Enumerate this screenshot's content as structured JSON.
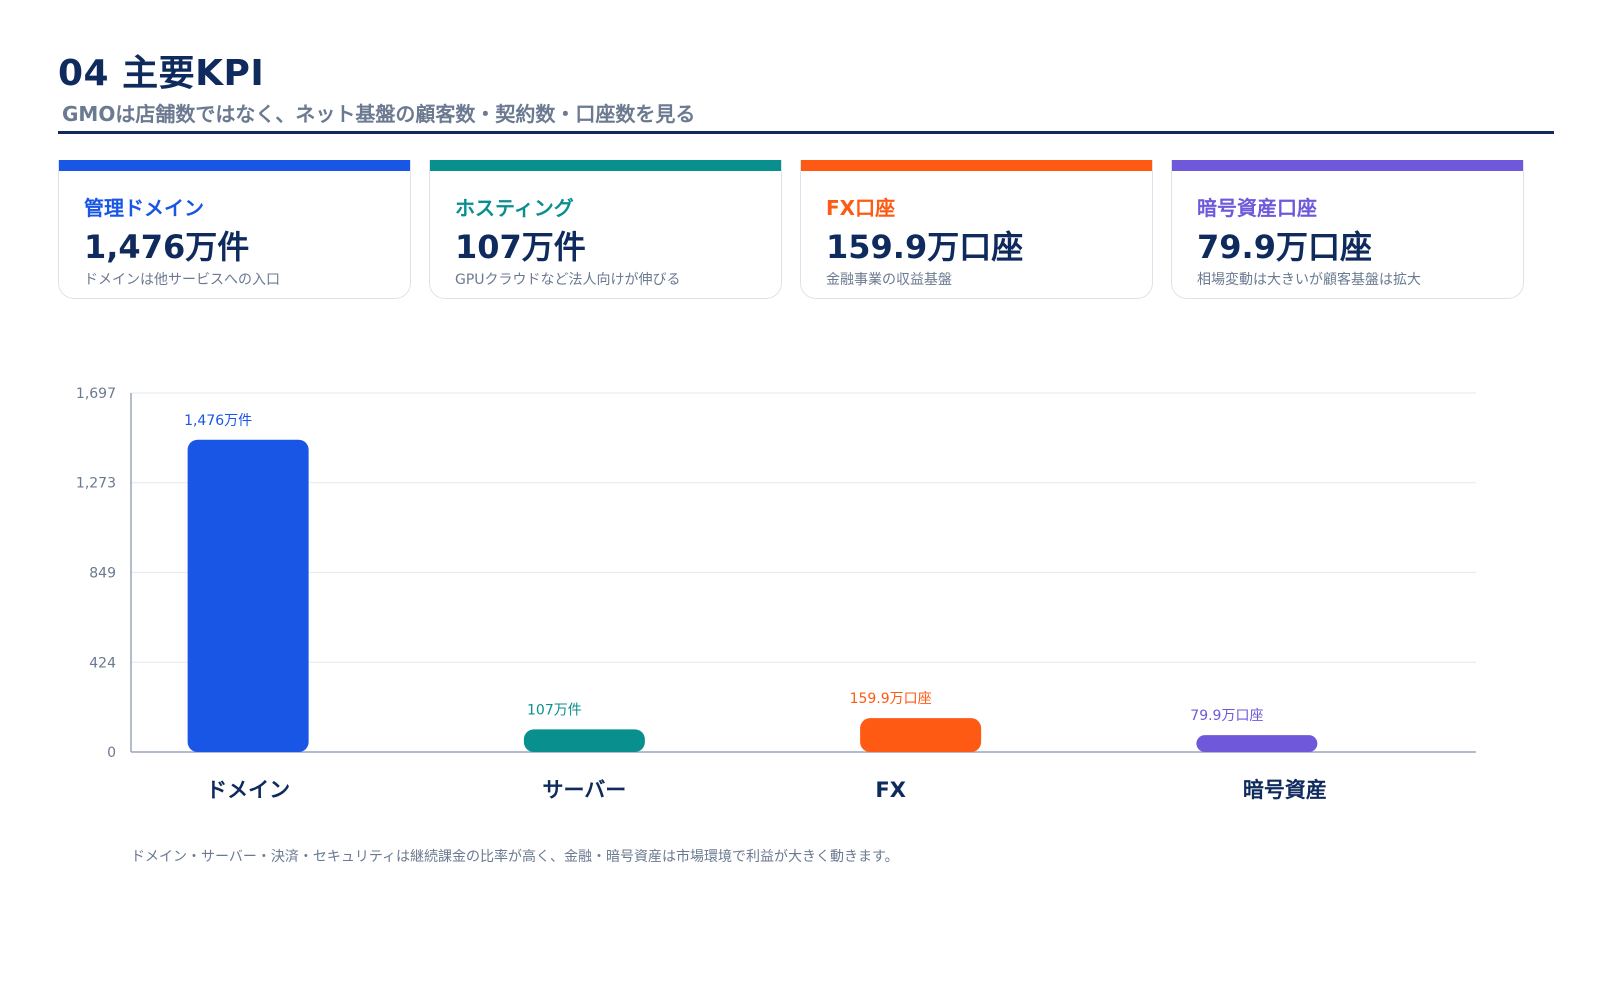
{
  "header": {
    "title": "04 主要KPI",
    "subtitle": "GMOは店舗数ではなく、ネット基盤の顧客数・契約数・口座数を見る"
  },
  "cards": [
    {
      "label": "管理ドメイン",
      "value": "1,476万件",
      "note": "ドメインは他サービスへの入口",
      "color": "#1a56e6"
    },
    {
      "label": "ホスティング",
      "value": "107万件",
      "note": "GPUクラウドなど法人向けが伸びる",
      "color": "#0a8f8f"
    },
    {
      "label": "FX口座",
      "value": "159.9万口座",
      "note": "金融事業の収益基盤",
      "color": "#ff5a14"
    },
    {
      "label": "暗号資産口座",
      "value": "79.9万口座",
      "note": "相場変動は大きいが顧客基盤は拡大",
      "color": "#6f58d9"
    }
  ],
  "chart_data": {
    "type": "bar",
    "categories": [
      "ドメイン",
      "サーバー",
      "FX",
      "暗号資産"
    ],
    "values": [
      1476,
      107,
      159.9,
      79.9
    ],
    "data_labels": [
      "1,476万件",
      "107万件",
      "159.9万口座",
      "79.9万口座"
    ],
    "colors": [
      "#1a56e6",
      "#0a8f8f",
      "#ff5a14",
      "#6f58d9"
    ],
    "y_ticks": [
      "0",
      "424",
      "849",
      "1,273",
      "1,697"
    ],
    "y_tick_values": [
      0,
      424,
      849,
      1273,
      1697
    ],
    "ylim": [
      0,
      1697
    ],
    "grid": true,
    "title": "",
    "xlabel": "",
    "ylabel": ""
  },
  "footnote": "ドメイン・サーバー・決済・セキュリティは継続課金の比率が高く、金融・暗号資産は市場環境で利益が大きく動きます。"
}
